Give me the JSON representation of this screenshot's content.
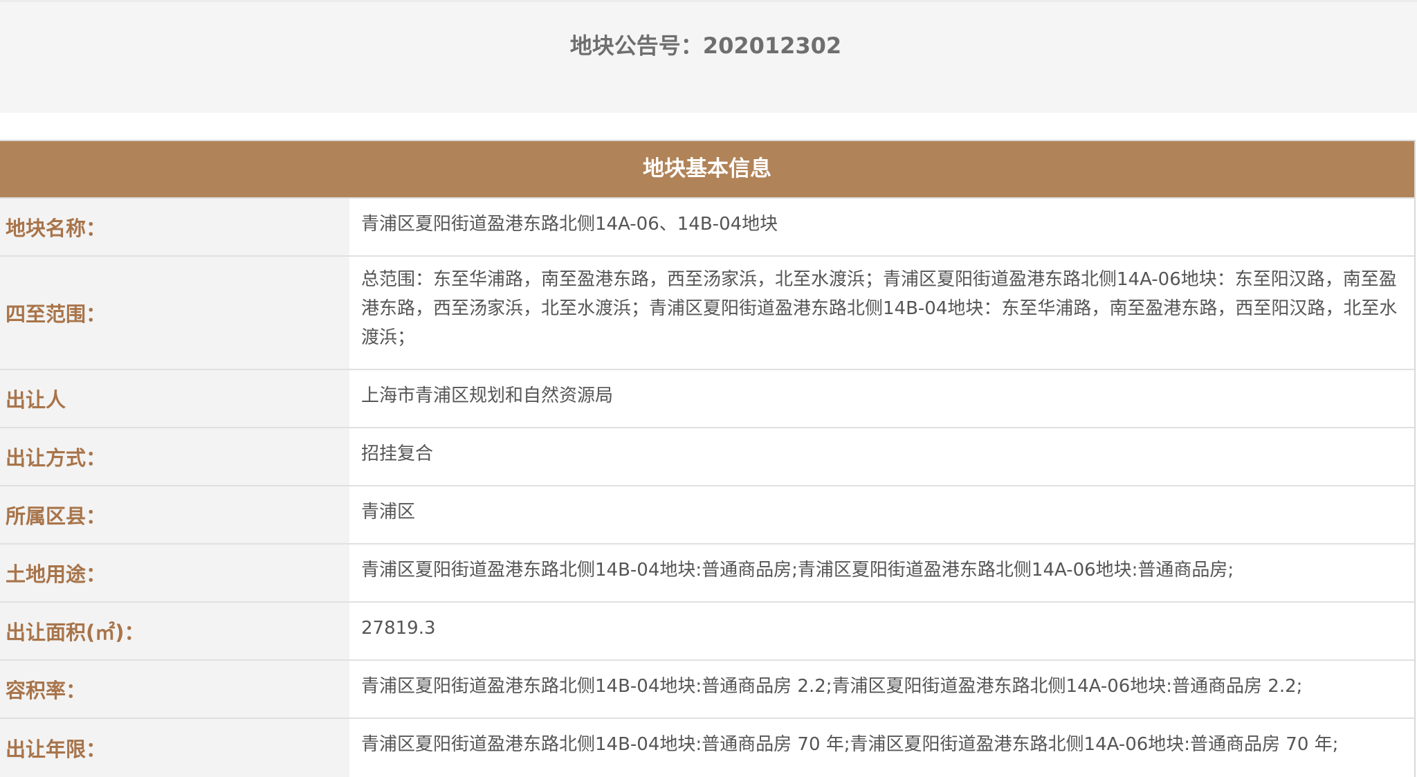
{
  "notice": {
    "title": "地块公告号：202012302"
  },
  "panel": {
    "title": "地块基本信息"
  },
  "rows": [
    {
      "label": "地块名称：",
      "value": "青浦区夏阳街道盈港东路北侧14A-06、14B-04地块"
    },
    {
      "label": "四至范围：",
      "value": "总范围：东至华浦路，南至盈港东路，西至汤家浜，北至水渡浜；青浦区夏阳街道盈港东路北侧14A-06地块：东至阳汉路，南至盈港东路，西至汤家浜，北至水渡浜；青浦区夏阳街道盈港东路北侧14B-04地块：东至华浦路，南至盈港东路，西至阳汉路，北至水渡浜；"
    },
    {
      "label": "出让人",
      "value": "上海市青浦区规划和自然资源局"
    },
    {
      "label": "出让方式：",
      "value": "招挂复合"
    },
    {
      "label": "所属区县：",
      "value": "青浦区"
    },
    {
      "label": "土地用途：",
      "value": "青浦区夏阳街道盈港东路北侧14B-04地块:普通商品房;青浦区夏阳街道盈港东路北侧14A-06地块:普通商品房;"
    },
    {
      "label": "出让面积(㎡)：",
      "value": "27819.3"
    },
    {
      "label": "容积率：",
      "value": "青浦区夏阳街道盈港东路北侧14B-04地块:普通商品房 2.2;青浦区夏阳街道盈港东路北侧14A-06地块:普通商品房 2.2;"
    },
    {
      "label": "出让年限：",
      "value": "青浦区夏阳街道盈港东路北侧14B-04地块:普通商品房 70 年;青浦区夏阳街道盈港东路北侧14A-06地块:普通商品房 70 年;"
    }
  ]
}
